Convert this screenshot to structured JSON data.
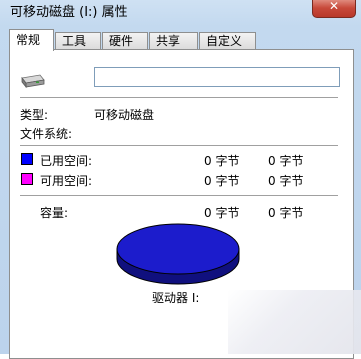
{
  "window": {
    "title": "可移动磁盘 (I:) 属性",
    "close_label": "✕"
  },
  "tabs": [
    {
      "label": "常规"
    },
    {
      "label": "工具"
    },
    {
      "label": "硬件"
    },
    {
      "label": "共享"
    },
    {
      "label": "自定义"
    }
  ],
  "general": {
    "drive_name_value": "",
    "type_label": "类型:",
    "type_value": "可移动磁盘",
    "filesystem_label": "文件系统:",
    "filesystem_value": "",
    "used_label": "已用空间:",
    "used_bytes": "0 字节",
    "used_size": "0 字节",
    "free_label": "可用空间:",
    "free_bytes": "0 字节",
    "free_size": "0 字节",
    "capacity_label": "容量:",
    "capacity_bytes": "0 字节",
    "capacity_size": "0 字节",
    "drive_label": "驱动器 I:"
  },
  "colors": {
    "used": "#0000ff",
    "free": "#ff00ff",
    "pie_top": "#1c1ccc",
    "pie_side": "#10107e"
  },
  "icons": {
    "drive": "removable-drive-icon"
  }
}
